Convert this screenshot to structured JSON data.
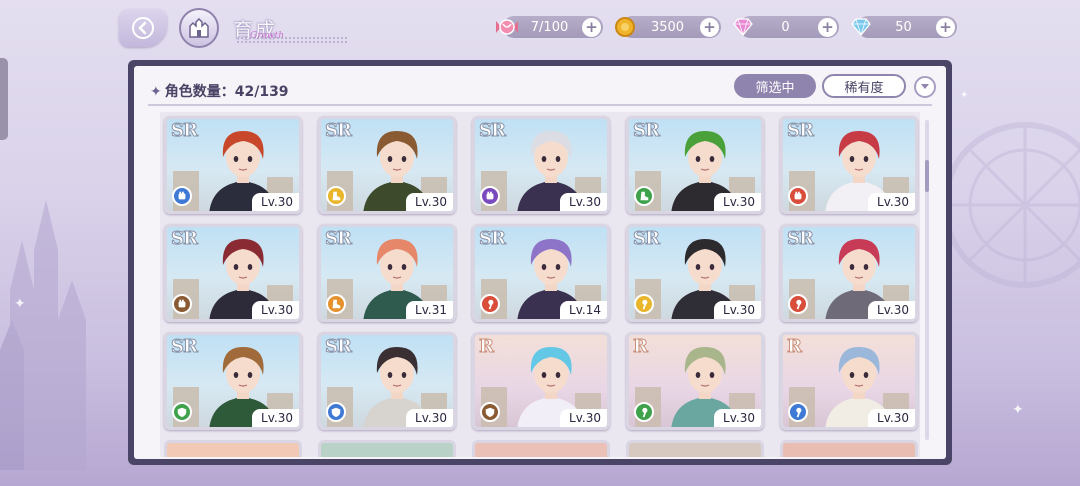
{
  "header": {
    "title": "育成",
    "title_decoration": "Growth"
  },
  "currencies": [
    {
      "name": "stamina",
      "icon": "candy-icon",
      "value": "7/100"
    },
    {
      "name": "gold",
      "icon": "gold-coin-icon",
      "value": "3500"
    },
    {
      "name": "pink-gem",
      "icon": "pink-diamond-icon",
      "value": "0"
    },
    {
      "name": "blue-gem",
      "icon": "blue-diamond-icon",
      "value": "50"
    }
  ],
  "panel": {
    "count_label": "角色数量：42/139",
    "filter_label": "筛选中",
    "rarity_label": "稀有度"
  },
  "colors": {
    "element_blue": "#3f79d6",
    "element_yellow": "#e9b52a",
    "element_purple": "#7a4bbf",
    "element_green": "#3ea24a",
    "element_red": "#d94e3a",
    "element_orange": "#e4912e",
    "element_brown": "#8a5a33"
  },
  "characters": [
    {
      "rarity": "SR",
      "level": "Lv.30",
      "element": "blue",
      "icon": "fist-icon",
      "hair": "#c8472a",
      "outfit": "#2b2c3c"
    },
    {
      "rarity": "SR",
      "level": "Lv.30",
      "element": "yellow",
      "icon": "boot-icon",
      "hair": "#8a5a33",
      "outfit": "#3d4a2c"
    },
    {
      "rarity": "SR",
      "level": "Lv.30",
      "element": "purple",
      "icon": "fist-icon",
      "hair": "#dcdce4",
      "outfit": "#3a3150"
    },
    {
      "rarity": "SR",
      "level": "Lv.30",
      "element": "green",
      "icon": "boot-icon",
      "hair": "#4aa13a",
      "outfit": "#2e2b30"
    },
    {
      "rarity": "SR",
      "level": "Lv.30",
      "element": "red",
      "icon": "fist-icon",
      "hair": "#c73b45",
      "outfit": "#f2f0f5"
    },
    {
      "rarity": "SR",
      "level": "Lv.30",
      "element": "brown",
      "icon": "fist-icon",
      "hair": "#8a2a33",
      "outfit": "#2d2b3a"
    },
    {
      "rarity": "SR",
      "level": "Lv.31",
      "element": "orange",
      "icon": "boot-icon",
      "hair": "#e6876a",
      "outfit": "#2f5a4e"
    },
    {
      "rarity": "SR",
      "level": "Lv.14",
      "element": "red",
      "icon": "wand-icon",
      "hair": "#8e74c8",
      "outfit": "#3a304f"
    },
    {
      "rarity": "SR",
      "level": "Lv.30",
      "element": "yellow",
      "icon": "wand-icon",
      "hair": "#2d2a2e",
      "outfit": "#2f2d35"
    },
    {
      "rarity": "SR",
      "level": "Lv.30",
      "element": "red",
      "icon": "wand-icon",
      "hair": "#c83b56",
      "outfit": "#6e6a77"
    },
    {
      "rarity": "SR",
      "level": "Lv.30",
      "element": "green",
      "icon": "shield-icon",
      "hair": "#a06a3a",
      "outfit": "#2f5a3a"
    },
    {
      "rarity": "SR",
      "level": "Lv.30",
      "element": "blue",
      "icon": "shield-icon",
      "hair": "#3a3033",
      "outfit": "#d7d3cf"
    },
    {
      "rarity": "R",
      "level": "Lv.30",
      "element": "brown",
      "icon": "shield-icon",
      "hair": "#63c7e6",
      "outfit": "#f1eef8"
    },
    {
      "rarity": "R",
      "level": "Lv.30",
      "element": "green",
      "icon": "wand-icon",
      "hair": "#a9b58a",
      "outfit": "#6aa7a0"
    },
    {
      "rarity": "R",
      "level": "Lv.30",
      "element": "blue",
      "icon": "wand-icon",
      "hair": "#9bb7da",
      "outfit": "#f1ece4"
    }
  ]
}
